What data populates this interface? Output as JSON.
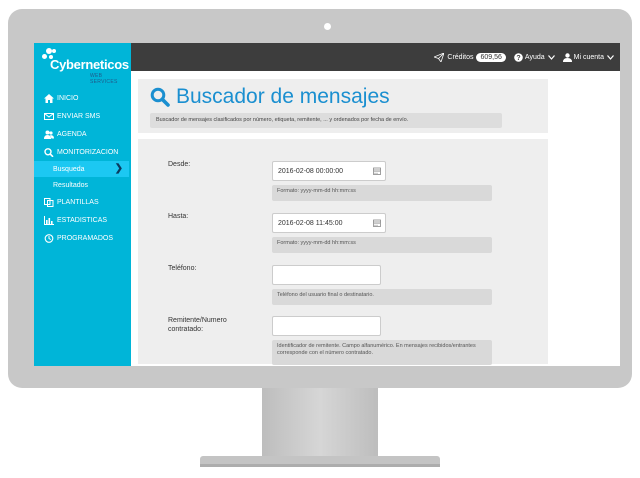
{
  "brand": {
    "name": "Cyberneticos",
    "tagline": "WEB SERVICES",
    "accent": "#00b5d8",
    "dark": "#3d3d3d",
    "title_color": "#1a8fd0"
  },
  "topbar": {
    "credits_label": "Créditos",
    "credits_value": "609,56",
    "help_label": "Ayuda",
    "account_label": "Mi cuenta"
  },
  "sidebar": {
    "items": [
      {
        "label": "INICIO",
        "icon": "home-icon"
      },
      {
        "label": "ENVIAR SMS",
        "icon": "envelope-icon"
      },
      {
        "label": "AGENDA",
        "icon": "users-icon"
      },
      {
        "label": "MONITORIZACION",
        "icon": "search-icon"
      },
      {
        "label": "PLANTILLAS",
        "icon": "copy-icon"
      },
      {
        "label": "ESTADISTICAS",
        "icon": "bar-chart-icon"
      },
      {
        "label": "PROGRAMADOS",
        "icon": "clock-icon"
      }
    ],
    "subitems": [
      {
        "label": "Busqueda"
      },
      {
        "label": "Resultados"
      }
    ]
  },
  "page": {
    "title": "Buscador de mensajes",
    "description": "Buscador de mensajes clasificados por número, etiqueta, remitente, ... y ordenados por fecha de envío."
  },
  "form": {
    "desde": {
      "label": "Desde:",
      "value": "2016-02-08 00:00:00",
      "help": "Formato: yyyy-mm-dd hh:mm:ss"
    },
    "hasta": {
      "label": "Hasta:",
      "value": "2016-02-08 11:45:00",
      "help": "Formato: yyyy-mm-dd hh:mm:ss"
    },
    "telefono": {
      "label": "Teléfono:",
      "value": "",
      "help": "Teléfono del usuario final o destinatario."
    },
    "remitente": {
      "label": "Remitente/Numero contratado:",
      "value": "",
      "help": "Identificador de remitente. Campo alfanumérico. En mensajes recibidos/entrantes corresponde con el número contratado."
    }
  }
}
